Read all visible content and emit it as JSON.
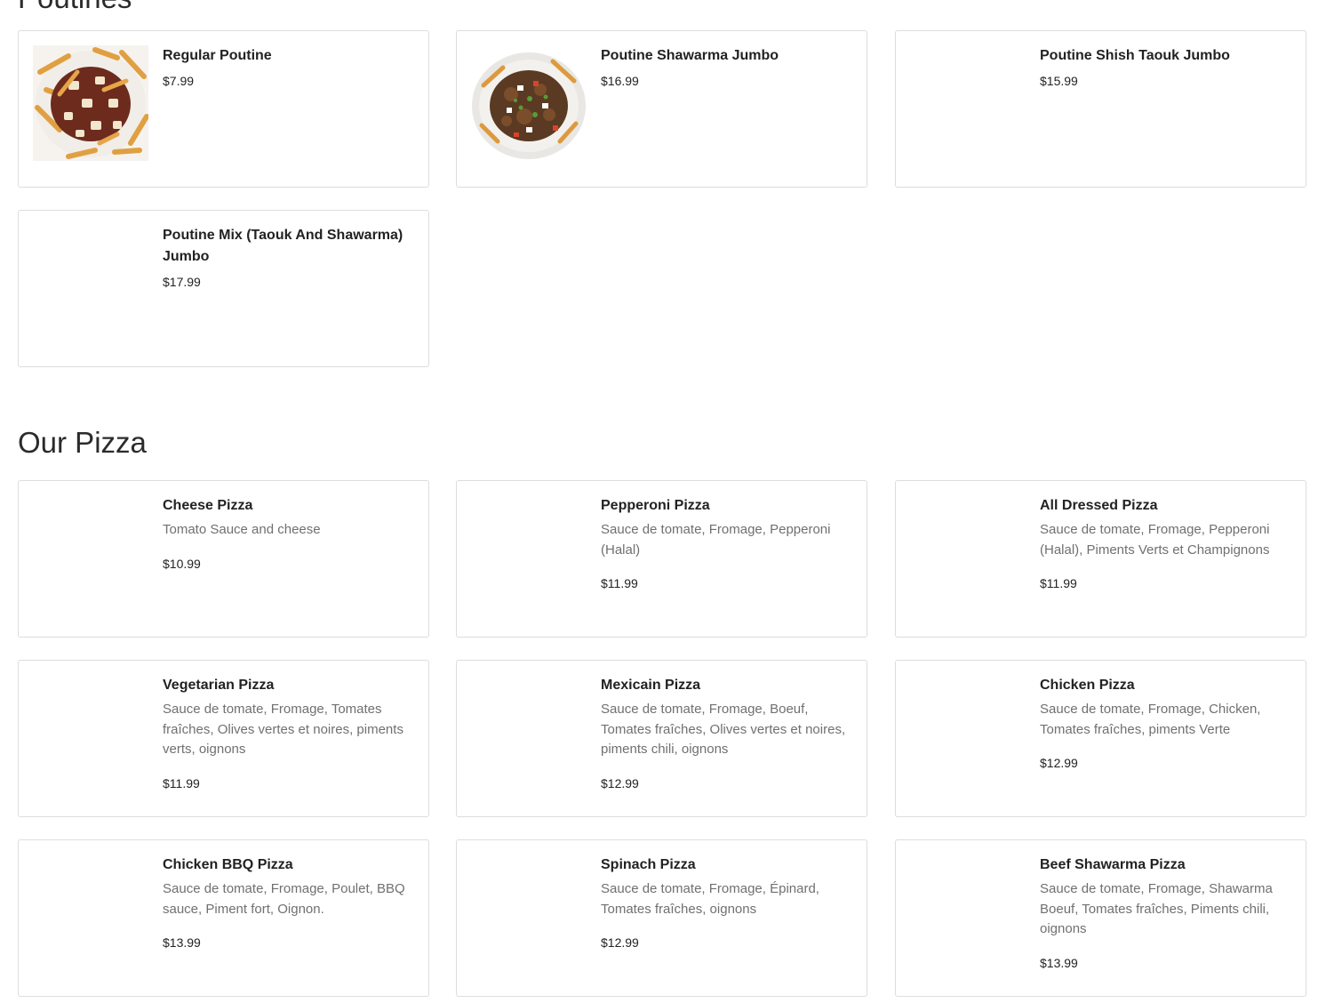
{
  "sections": {
    "poutines": {
      "title": "Poutines",
      "items": [
        {
          "name": "Regular Poutine",
          "price": "$7.99",
          "image": "poutine-photo"
        },
        {
          "name": "Poutine Shawarma Jumbo",
          "price": "$16.99",
          "image": "poutine-shawarma-photo"
        },
        {
          "name": "Poutine Shish Taouk Jumbo",
          "price": "$15.99"
        },
        {
          "name": "Poutine Mix (Taouk And Shawarma) Jumbo",
          "price": "$17.99"
        }
      ]
    },
    "pizza": {
      "title": "Our Pizza",
      "items": [
        {
          "name": "Cheese Pizza",
          "desc": "Tomato Sauce and cheese",
          "price": "$10.99"
        },
        {
          "name": "Pepperoni Pizza",
          "desc": "Sauce de tomate, Fromage, Pepperoni (Halal)",
          "price": "$11.99"
        },
        {
          "name": "All Dressed Pizza",
          "desc": "Sauce de tomate, Fromage, Pepperoni (Halal), Piments Verts et Champignons",
          "price": "$11.99"
        },
        {
          "name": "Vegetarian Pizza",
          "desc": "Sauce de tomate, Fromage, Tomates fraîches, Olives vertes et noires, piments verts, oignons",
          "price": "$11.99"
        },
        {
          "name": "Mexicain Pizza",
          "desc": "Sauce de tomate, Fromage, Boeuf, Tomates fraîches, Olives vertes et noires, piments chili, oignons",
          "price": "$12.99"
        },
        {
          "name": "Chicken Pizza",
          "desc": "Sauce de tomate, Fromage, Chicken, Tomates fraîches, piments Verte",
          "price": "$12.99"
        },
        {
          "name": "Chicken BBQ Pizza",
          "desc": "Sauce de tomate, Fromage, Poulet, BBQ sauce, Piment fort, Oignon.",
          "price": "$13.99"
        },
        {
          "name": "Spinach Pizza",
          "desc": "Sauce de tomate, Fromage, Épinard, Tomates fraîches, oignons",
          "price": "$12.99"
        },
        {
          "name": "Beef Shawarma Pizza",
          "desc": "Sauce de tomate, Fromage, Shawarma Boeuf, Tomates fraîches, Piments chili, oignons",
          "price": "$13.99"
        }
      ]
    }
  }
}
